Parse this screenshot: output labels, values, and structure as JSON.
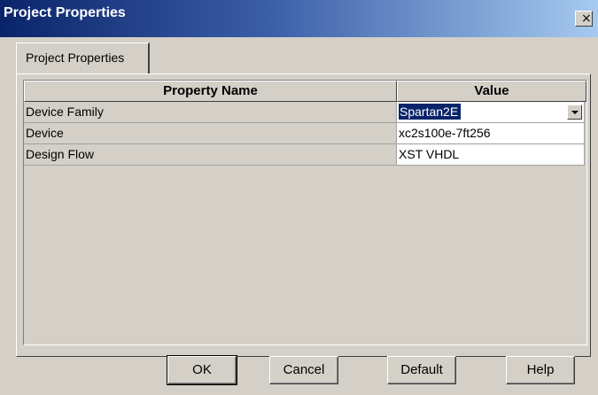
{
  "window": {
    "title": "Project Properties",
    "close_glyph": "×"
  },
  "tabs": [
    {
      "label": "Project Properties",
      "active": true
    }
  ],
  "grid": {
    "columns": [
      "Property Name",
      "Value"
    ],
    "rows": [
      {
        "name": "Device Family",
        "value": "Spartan2E",
        "control": "dropdown",
        "selected": true
      },
      {
        "name": "Device",
        "value": "xc2s100e-7ft256"
      },
      {
        "name": "Design Flow",
        "value": "XST VHDL"
      }
    ]
  },
  "buttons": {
    "ok": "OK",
    "cancel": "Cancel",
    "default": "Default",
    "help": "Help"
  },
  "colors": {
    "title_bar": "#0a246a",
    "dialog_face": "#d4d0c8",
    "selection": "#0a246a"
  }
}
